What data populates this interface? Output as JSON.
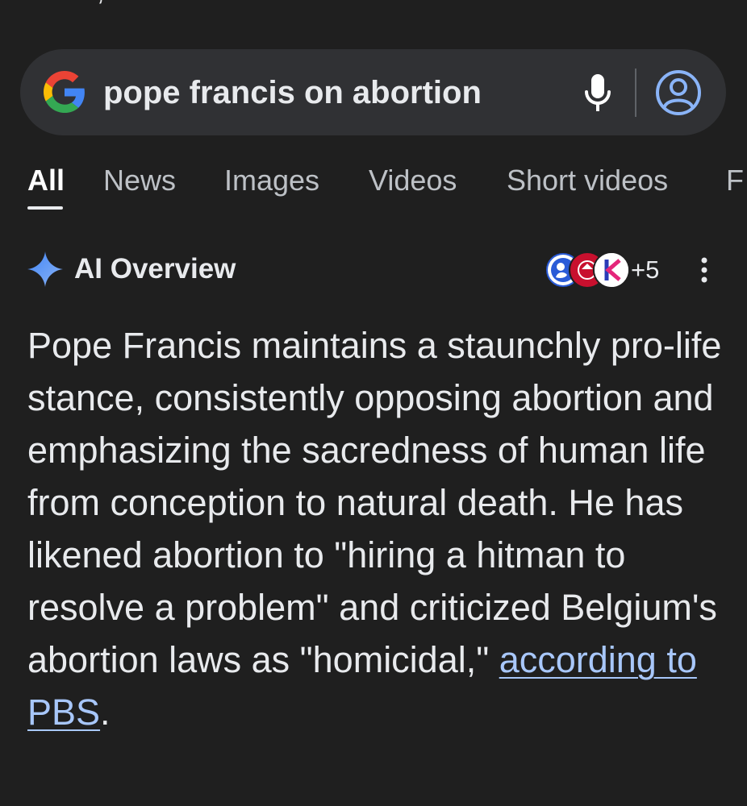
{
  "search": {
    "query": "pope francis on abortion"
  },
  "tabs": [
    {
      "label": "All",
      "active": true
    },
    {
      "label": "News",
      "active": false
    },
    {
      "label": "Images",
      "active": false
    },
    {
      "label": "Videos",
      "active": false
    },
    {
      "label": "Short videos",
      "active": false
    },
    {
      "label": "F",
      "active": false
    }
  ],
  "ai_overview": {
    "title": "AI Overview",
    "sources_more": "+5",
    "body": "Pope Francis maintains a staunchly pro-life stance, consistently opposing abortion and emphasizing the sacredness of human life from conception to natural death. He has likened abortion to \"hiring a hitman to resolve a problem\" and criticized Belgium's abortion laws as \"homicidal,\" ",
    "link_text": "according to PBS",
    "body_end": "."
  },
  "icons": {
    "logo": "google-g-icon",
    "mic": "mic-icon",
    "account": "account-icon",
    "sparkle": "sparkle-icon",
    "more": "more-vert-icon"
  },
  "colors": {
    "background": "#1f1f1f",
    "search_bar": "#303134",
    "text": "#e8eaed",
    "tab_inactive": "#bdc1c6",
    "link": "#a8c7fa",
    "account_blue": "#8ab4f8"
  }
}
